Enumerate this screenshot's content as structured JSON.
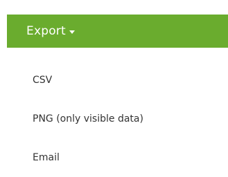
{
  "export_button": {
    "label": "Export",
    "icon": "caret-down-icon",
    "bg_color": "#6aac2e",
    "text_color": "#ffffff"
  },
  "menu": {
    "items": [
      {
        "label": "CSV"
      },
      {
        "label": "PNG (only visible data)"
      },
      {
        "label": "Email"
      }
    ]
  }
}
